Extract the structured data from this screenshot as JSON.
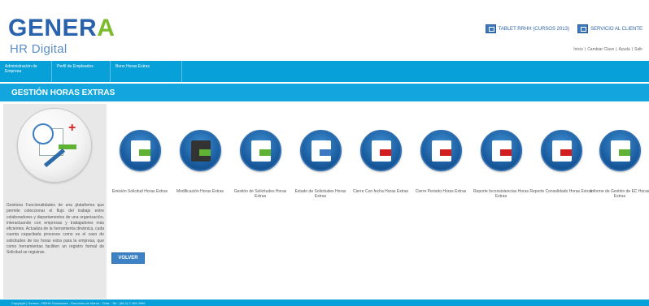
{
  "brand": {
    "name_main": "GENER",
    "name_accent": "A",
    "subtitle": "HR Digital"
  },
  "top_links": [
    {
      "label": "TABLET RRHH (CURSOS 2013)",
      "icon": "tablet-icon"
    },
    {
      "label": "SERVICIO AL CLIENTE",
      "icon": "customer-service-icon"
    }
  ],
  "user_links": [
    "Inicio",
    "Cambiar Clave",
    "Ayuda",
    "Salir"
  ],
  "nav": [
    "Administración de Empresa",
    "Perfil de Empleados",
    "Bono Horas Extras"
  ],
  "section_title": "GESTIÓN HORAS EXTRAS",
  "left_panel": {
    "icon": "overtime-clock-document-icon",
    "description": "Gestiona Funcionalidades de una plataforma que permite coleccionar el flujo del trabajo entre colaboradores y departamentos de una organización, interactuando con empresas y trabajadores más eficientes. Actualiza de la herramienta dinámica, cada cuenta capacitada procesos como es el caso de solicitudes de los horas extra para la empresa, que como herramientas faciliten un registro formal de Solicitud se registran."
  },
  "actions": [
    {
      "label": "Emisión Solicitud Horas Extras",
      "icon": "emit-request-icon"
    },
    {
      "label": "Modificación Horas Extras",
      "icon": "modify-document-icon"
    },
    {
      "label": "Gestión de Solicitudes Horas Extras",
      "icon": "manage-requests-icon"
    },
    {
      "label": "Estado de Solicitudes Horas Extras",
      "icon": "request-status-icon"
    },
    {
      "label": "Cierre Con fecha Horas Extras",
      "icon": "close-date-icon"
    },
    {
      "label": "Cierre Periodo Horas Extras",
      "icon": "close-period-icon"
    },
    {
      "label": "Reporte Inconsistencias Horas Extras",
      "icon": "inconsistency-report-icon"
    },
    {
      "label": "Reporte Consolidado Horas Extras",
      "icon": "consolidated-report-icon"
    },
    {
      "label": "Informe de Gestión de EC Horas Extras",
      "icon": "management-report-icon"
    }
  ],
  "back_button": "VOLVER",
  "footer": "Copyright | Genera - RRHH Soluciones - Derechos de Marca - Chile - Tel.: (56-2) 2 499 9999",
  "colors": {
    "brand_blue": "#2a63ad",
    "brand_green": "#7cbc2c",
    "nav_blue": "#08a0d8",
    "section_blue": "#13a6de",
    "icon_circle": "#195b9e"
  }
}
